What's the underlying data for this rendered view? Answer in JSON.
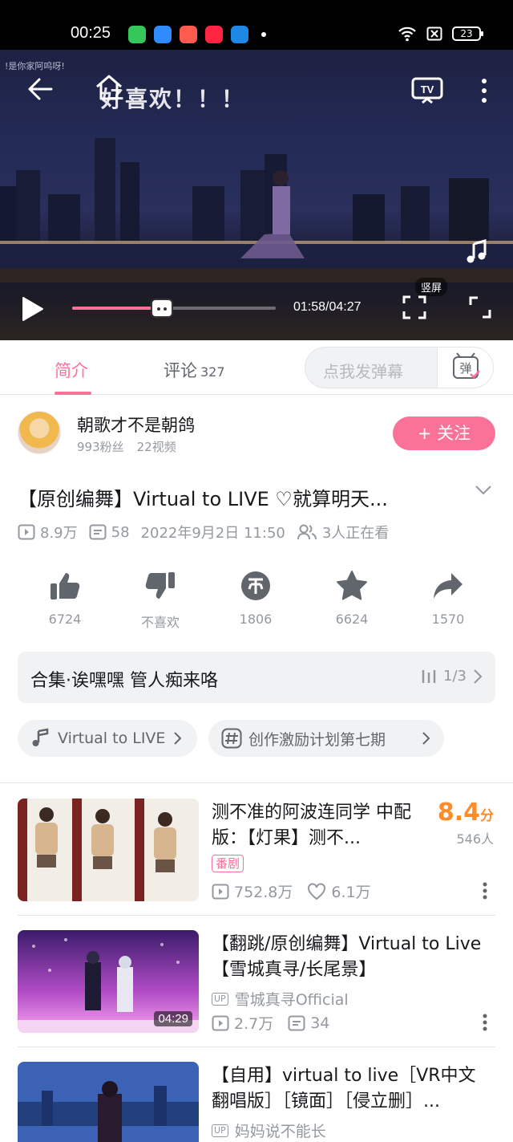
{
  "status_bar": {
    "time": "00:25",
    "battery": "23"
  },
  "player": {
    "danmaku_overlay": "!是你家阿呜呀!",
    "title_overlay": "好喜欢！！！",
    "time_display": "01:58/04:27",
    "progress": 0.44,
    "portrait_label": "竖屏"
  },
  "tabs": {
    "intro": "简介",
    "comments": "评论",
    "comments_count": "327",
    "danmaku_placeholder": "点我发弹幕",
    "danmaku_toggle": "弹"
  },
  "uploader": {
    "name": "朝歌才不是朝鸽",
    "fans": "993粉丝",
    "videos": "22视频",
    "follow_label": "+ 关注"
  },
  "video": {
    "title": "【原创编舞】Virtual to LIVE ♡就算明天...",
    "views": "8.9万",
    "danmaku_count": "58",
    "date": "2022年9月2日 11:50",
    "watching": "3人正在看"
  },
  "actions": {
    "like": "6724",
    "dislike": "不喜欢",
    "coin": "1806",
    "favorite": "6624",
    "share": "1570"
  },
  "collection": {
    "title": "合集·诶嘿嘿 管人痴来咯",
    "progress": "1/3"
  },
  "tags": {
    "music": "Virtual to LIVE",
    "topic": "创作激励计划第七期"
  },
  "recommendations": [
    {
      "title": "测不准的阿波连同学 中配版：【灯果】测不...",
      "badge": "番剧",
      "views": "752.8万",
      "likes": "6.1万",
      "score": "8.4",
      "score_unit": "分",
      "score_votes": "546人"
    },
    {
      "title": "【翻跳/原创编舞】Virtual to Live【雪城真寻/长尾景】",
      "upper": "雪城真寻Official",
      "views": "2.7万",
      "danmaku": "34",
      "duration": "04:29"
    },
    {
      "title": "【自用】virtual to live［VR中文翻唱版］［镜面］［侵立删］...",
      "upper": "妈妈说不能长"
    }
  ]
}
